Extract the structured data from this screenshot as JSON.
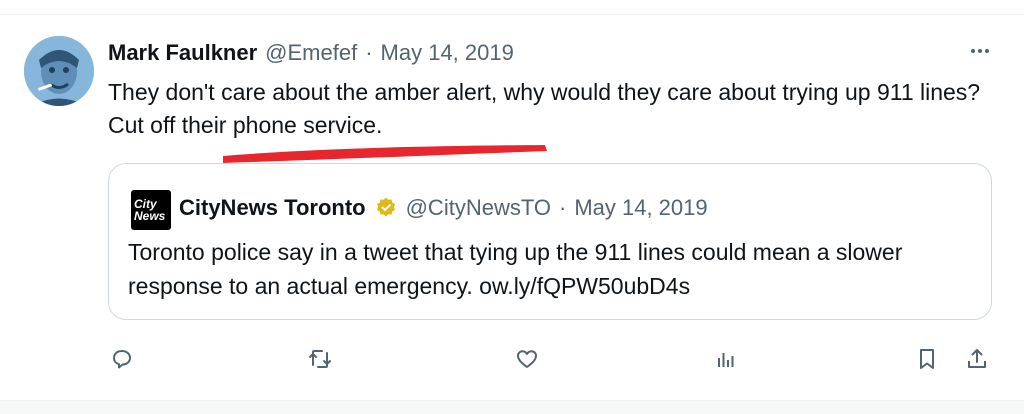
{
  "tweet": {
    "author_name": "Mark Faulkner",
    "handle": "@Emefef",
    "separator": "·",
    "date": "May 14, 2019",
    "text": "They don't care about the amber alert, why would they care about trying up 911 lines? Cut off their phone service."
  },
  "quoted_tweet": {
    "logo_line1": "City",
    "logo_line2": "News",
    "author_name": "CityNews Toronto",
    "handle": "@CityNewsTO",
    "separator": "·",
    "date": "May 14, 2019",
    "text": "Toronto police say in a tweet that tying up the 911 lines could mean a slower response to an actual emergency. ow.ly/fQPW50ubD4s"
  },
  "icons": {
    "more": "more-horizontal-icon",
    "reply": "reply-icon",
    "retweet": "retweet-icon",
    "like": "heart-icon",
    "views": "views-icon",
    "bookmark": "bookmark-icon",
    "share": "share-icon",
    "verified": "verified-badge-icon"
  },
  "colors": {
    "text": "#0f1419",
    "secondary": "#536471",
    "border": "#cfd9de",
    "highlight": "#e8262d",
    "verified_gold": "#e2b719"
  }
}
